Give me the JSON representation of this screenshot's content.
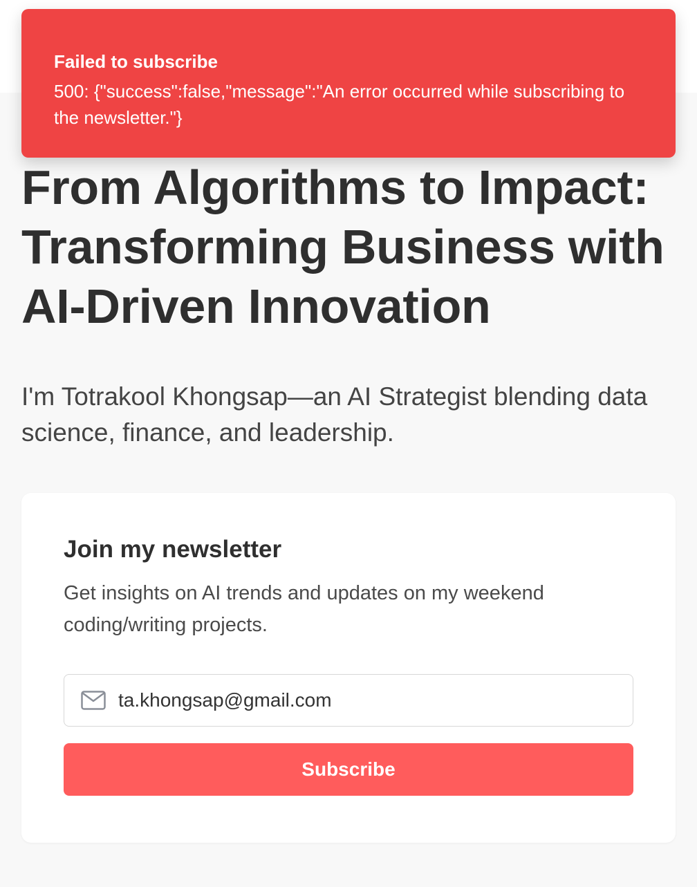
{
  "toast": {
    "title": "Failed to subscribe",
    "message": "500: {\"success\":false,\"message\":\"An error occurred while subscribing to the newsletter.\"}",
    "color": "#ef4444"
  },
  "hero": {
    "title": "From Algorithms to Impact: Transforming Business with AI-Driven Innovation",
    "subtitle": "I'm Totrakool Khongsap—an AI Strategist blending data science, finance, and leadership."
  },
  "newsletter": {
    "title": "Join my newsletter",
    "description": "Get insights on AI trends and updates on my weekend coding/writing projects.",
    "email_value": "ta.khongsap@gmail.com",
    "email_icon": "mail-icon",
    "subscribe_label": "Subscribe",
    "button_color": "#ff5c5c"
  }
}
